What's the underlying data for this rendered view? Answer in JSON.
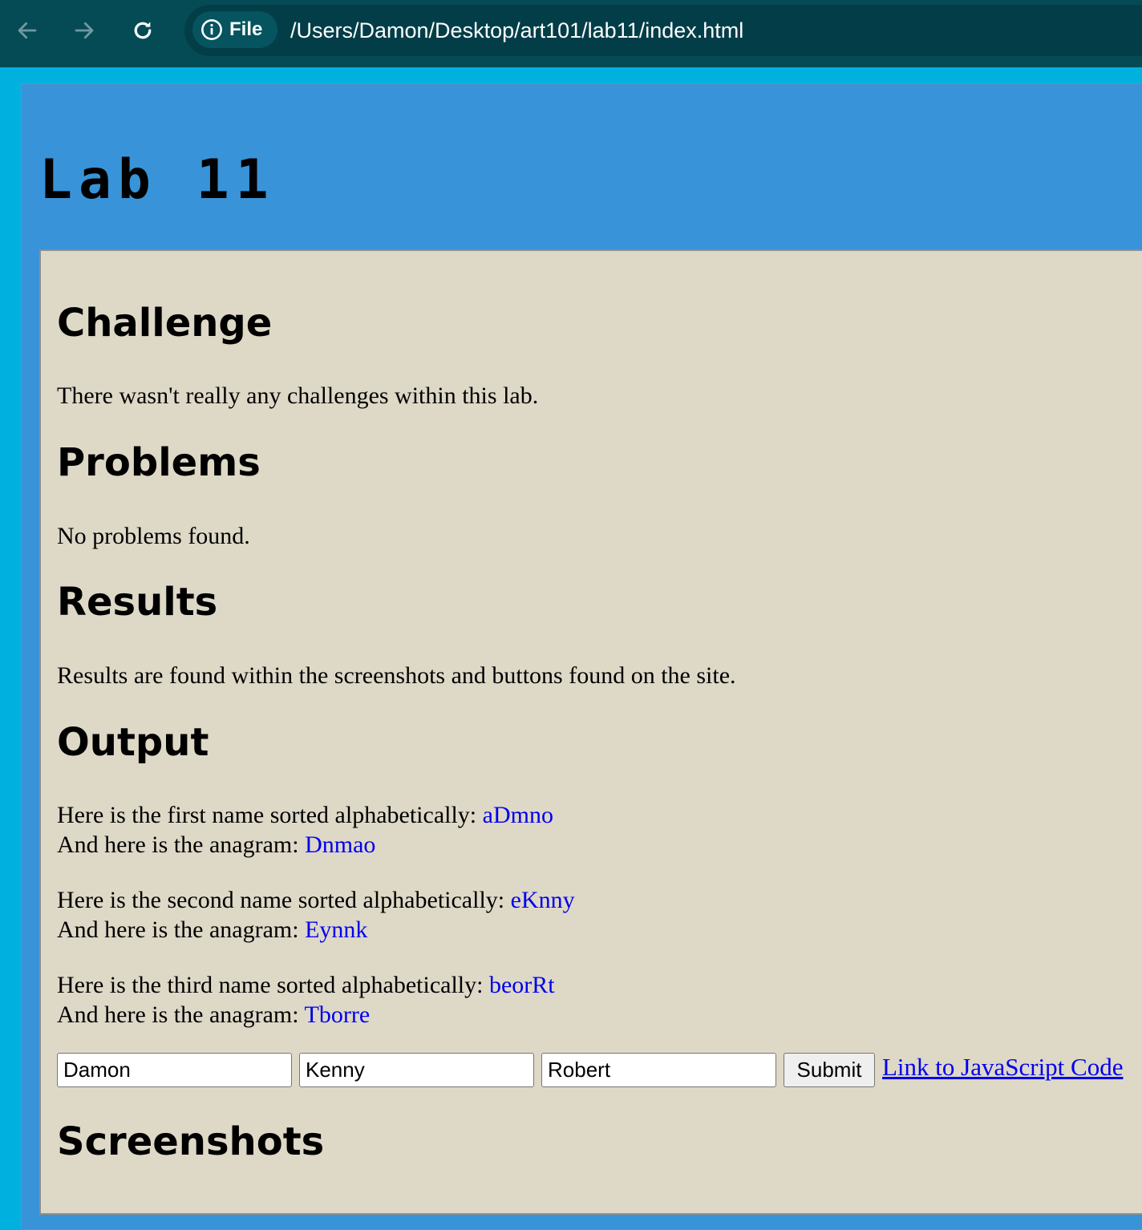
{
  "browser": {
    "site_chip_label": "File",
    "url": "/Users/Damon/Desktop/art101/lab11/index.html",
    "icons": [
      "back-arrow-icon",
      "forward-arrow-icon",
      "reload-icon",
      "info-icon"
    ]
  },
  "page": {
    "title": "Lab 11",
    "sections": {
      "challenge": {
        "heading": "Challenge",
        "text": "There wasn't really any challenges within this lab."
      },
      "problems": {
        "heading": "Problems",
        "text": "No problems found."
      },
      "results": {
        "heading": "Results",
        "text": "Results are found within the screenshots and buttons found on the site."
      },
      "output": {
        "heading": "Output",
        "entries": [
          {
            "sorted_prefix": "Here is the first name sorted alphabetically: ",
            "sorted_value": "aDmno",
            "anagram_prefix": "And here is the anagram: ",
            "anagram_value": "Dnmao"
          },
          {
            "sorted_prefix": "Here is the second name sorted alphabetically: ",
            "sorted_value": "eKnny",
            "anagram_prefix": "And here is the anagram: ",
            "anagram_value": "Eynnk"
          },
          {
            "sorted_prefix": "Here is the third name sorted alphabetically: ",
            "sorted_value": "beorRt",
            "anagram_prefix": "And here is the anagram: ",
            "anagram_value": "Tborre"
          }
        ]
      },
      "form": {
        "inputs": [
          "Damon",
          "Kenny",
          "Robert"
        ],
        "submit_label": "Submit",
        "link_label": "Link to JavaScript Code"
      },
      "screenshots": {
        "heading": "Screenshots"
      }
    }
  },
  "colors": {
    "toolbar_bg": "#054b55",
    "window_bg": "#00b1e0",
    "page_bg": "#3993d8",
    "content_bg": "#ded8c7",
    "highlight_text": "#0000ee"
  }
}
